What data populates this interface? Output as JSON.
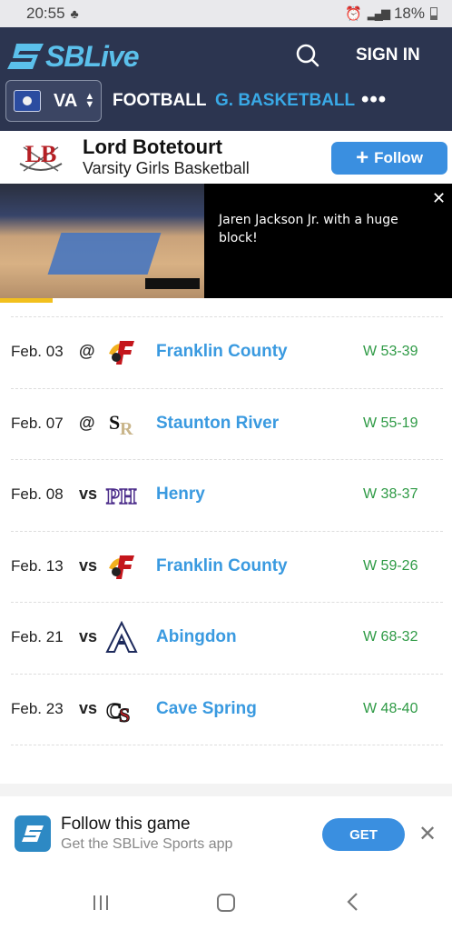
{
  "status_bar": {
    "time": "20:55",
    "battery": "18%"
  },
  "header": {
    "brand": "SBLive",
    "sign_in": "SIGN IN",
    "state": "VA",
    "nav": [
      "FOOTBALL",
      "G. BASKETBALL",
      "•••"
    ],
    "active_color": "#39a9e6",
    "bg_color": "#2c3550"
  },
  "team": {
    "abbr": "LB",
    "name": "Lord Botetourt",
    "subtitle": "Varsity Girls Basketball",
    "follow": "Follow"
  },
  "video": {
    "caption": "Jaren Jackson Jr. with a huge block!",
    "progress": 0.12
  },
  "games": [
    {
      "date": "Feb. 03",
      "loc": "@",
      "logo": "franklin-county-logo",
      "opponent": "Franklin County",
      "result": "W 53-39"
    },
    {
      "date": "Feb. 07",
      "loc": "@",
      "logo": "staunton-river-logo",
      "opponent": "Staunton River",
      "result": "W 55-19"
    },
    {
      "date": "Feb. 08",
      "loc": "vs",
      "logo": "henry-logo",
      "opponent": "Henry",
      "result": "W 38-37"
    },
    {
      "date": "Feb. 13",
      "loc": "vs",
      "logo": "franklin-county-logo",
      "opponent": "Franklin County",
      "result": "W 59-26"
    },
    {
      "date": "Feb. 21",
      "loc": "vs",
      "logo": "abingdon-logo",
      "opponent": "Abingdon",
      "result": "W 68-32"
    },
    {
      "date": "Feb. 23",
      "loc": "vs",
      "logo": "cave-spring-logo",
      "opponent": "Cave Spring",
      "result": "W 48-40"
    }
  ],
  "app_banner": {
    "title": "Follow this game",
    "subtitle": "Get the SBLive Sports app",
    "get": "GET"
  }
}
